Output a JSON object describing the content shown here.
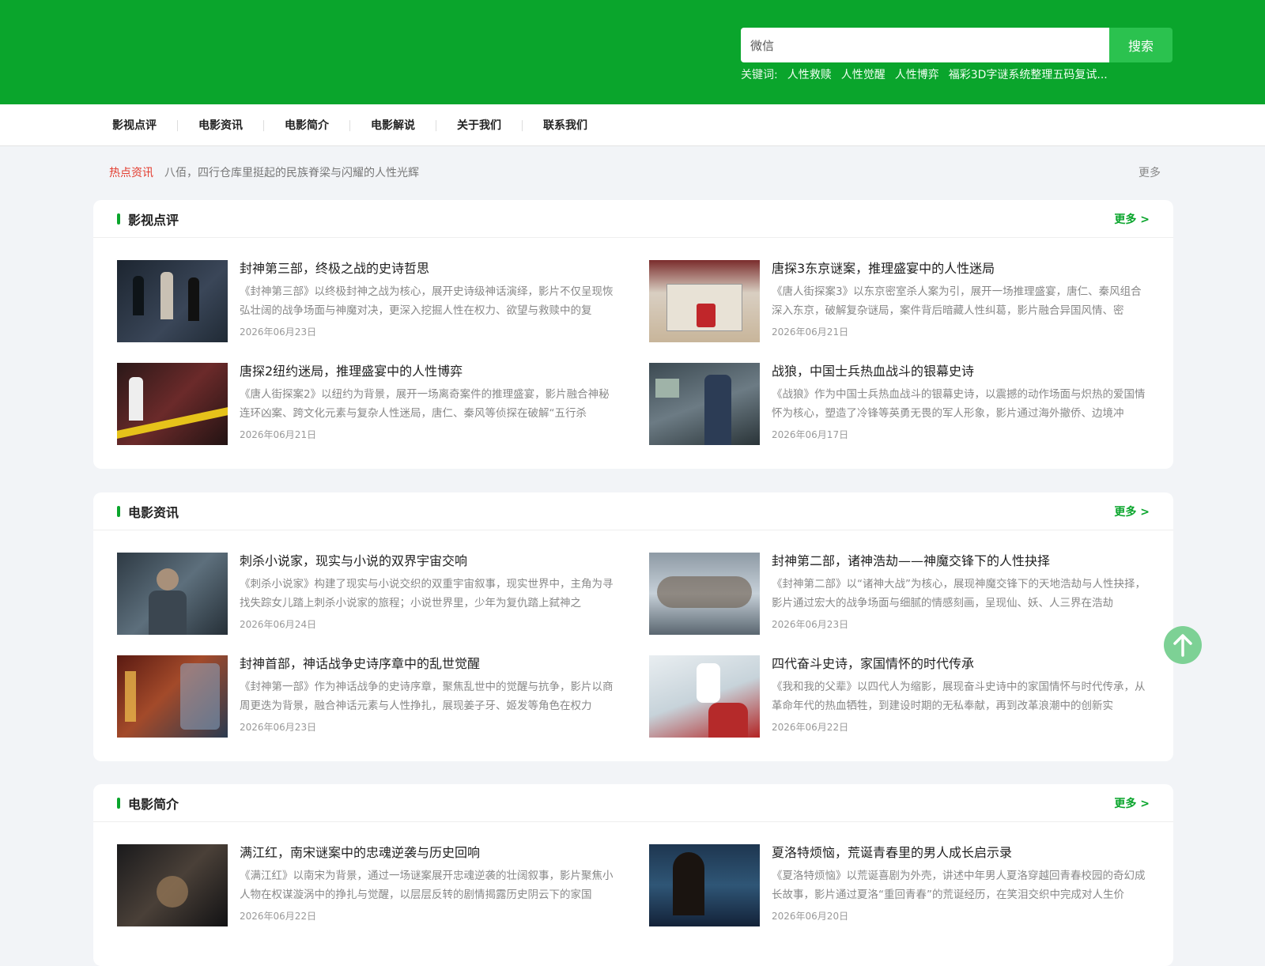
{
  "header": {
    "search_value": "微信",
    "search_button": "搜索",
    "keywords_label": "关键词:",
    "keywords": [
      "人性救赎",
      "人性觉醒",
      "人性博弈",
      "福彩3D字谜系统整理五码复试..."
    ]
  },
  "nav": [
    "影视点评",
    "电影资讯",
    "电影简介",
    "电影解说",
    "关于我们",
    "联系我们"
  ],
  "hot": {
    "label": "热点资讯",
    "text": "八佰，四行仓库里挺起的民族脊梁与闪耀的人性光辉",
    "more": "更多"
  },
  "sections": [
    {
      "title": "影视点评",
      "more": "更多 >",
      "items": [
        {
          "title": "封神第三部，终极之战的史诗哲思",
          "desc": "《封神第三部》以终极封神之战为核心，展开史诗级神话演绎，影片不仅呈现恢弘壮阔的战争场面与神魔对决，更深入挖掘人性在权力、欲望与救赎中的复",
          "date": "2026年06月23日"
        },
        {
          "title": "唐探3东京谜案，推理盛宴中的人性迷局",
          "desc": "《唐人街探案3》以东京密室杀人案为引，展开一场推理盛宴，唐仁、秦风组合深入东京，破解复杂谜局，案件背后暗藏人性纠葛，影片融合异国风情、密",
          "date": "2026年06月21日"
        },
        {
          "title": "唐探2纽约迷局，推理盛宴中的人性博弈",
          "desc": "《唐人街探案2》以纽约为背景，展开一场离奇案件的推理盛宴，影片融合神秘连环凶案、跨文化元素与复杂人性迷局，唐仁、秦风等侦探在破解“五行杀",
          "date": "2026年06月21日"
        },
        {
          "title": "战狼，中国士兵热血战斗的银幕史诗",
          "desc": "《战狼》作为中国士兵热血战斗的银幕史诗，以震撼的动作场面与炽热的爱国情怀为核心，塑造了冷锋等英勇无畏的军人形象，影片通过海外撤侨、边境冲",
          "date": "2026年06月17日"
        }
      ]
    },
    {
      "title": "电影资讯",
      "more": "更多 >",
      "items": [
        {
          "title": "刺杀小说家，现实与小说的双界宇宙交响",
          "desc": "《刺杀小说家》构建了现实与小说交织的双重宇宙叙事，现实世界中，主角为寻找失踪女儿踏上刺杀小说家的旅程；小说世界里，少年为复仇踏上弑神之",
          "date": "2026年06月24日"
        },
        {
          "title": "封神第二部，诸神浩劫——神魔交锋下的人性抉择",
          "desc": "《封神第二部》以“诸神大战”为核心，展现神魔交锋下的天地浩劫与人性抉择，影片通过宏大的战争场面与细腻的情感刻画，呈现仙、妖、人三界在浩劫",
          "date": "2026年06月23日"
        },
        {
          "title": "封神首部，神话战争史诗序章中的乱世觉醒",
          "desc": "《封神第一部》作为神话战争的史诗序章，聚焦乱世中的觉醒与抗争，影片以商周更迭为背景，融合神话元素与人性挣扎，展现姜子牙、姬发等角色在权力",
          "date": "2026年06月23日"
        },
        {
          "title": "四代奋斗史诗，家国情怀的时代传承",
          "desc": "《我和我的父辈》以四代人为缩影，展现奋斗史诗中的家国情怀与时代传承，从革命年代的热血牺牲，到建设时期的无私奉献，再到改革浪潮中的创新实",
          "date": "2026年06月22日"
        }
      ]
    },
    {
      "title": "电影简介",
      "more": "更多 >",
      "items": [
        {
          "title": "满江红，南宋谜案中的忠魂逆袭与历史回响",
          "desc": "《满江红》以南宋为背景，通过一场谜案展开忠魂逆袭的壮阔叙事，影片聚焦小人物在权谋漩涡中的挣扎与觉醒，以层层反转的剧情揭露历史阴云下的家国",
          "date": "2026年06月22日"
        },
        {
          "title": "夏洛特烦恼，荒诞青春里的男人成长启示录",
          "desc": "《夏洛特烦恼》以荒诞喜剧为外壳，讲述中年男人夏洛穿越回青春校园的奇幻成长故事，影片通过夏洛“重回青春”的荒诞经历，在笑泪交织中完成对人生价",
          "date": "2026年06月20日"
        }
      ]
    }
  ]
}
